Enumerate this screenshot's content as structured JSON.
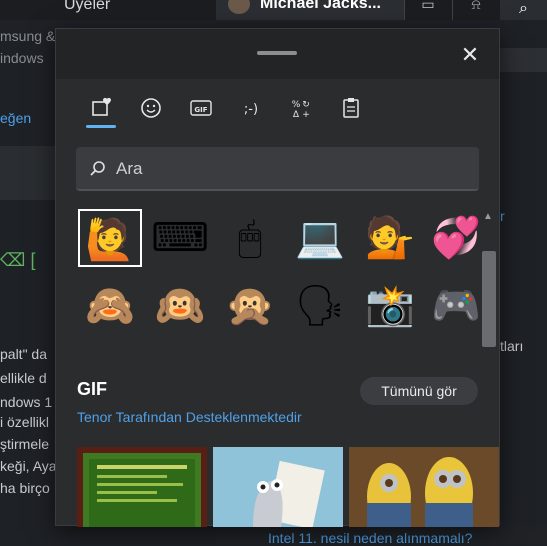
{
  "background": {
    "left_tab": "Üyeler",
    "active_tab_title": "Michael Jacks...",
    "side_lines_left": [
      "msung &",
      "indows"
    ],
    "side_link": "eğen",
    "article_lines": [
      "palt\" da",
      "ellikle d",
      "ndows 1",
      "i özellikl",
      "ştirmele",
      "keği, Aya",
      "ha birço"
    ],
    "right_text": "tları",
    "right_r": "r",
    "bottom_link": "Intel 11. nesil neden alınmamalı?"
  },
  "panel": {
    "close_label": "✕",
    "tabs": [
      {
        "name": "favorites",
        "icon": "heart-square-icon",
        "glyph": "♥"
      },
      {
        "name": "emoji",
        "icon": "smiley-icon",
        "glyph": "☺"
      },
      {
        "name": "gif",
        "icon": "gif-icon",
        "glyph": "GIF"
      },
      {
        "name": "kaomoji",
        "icon": "kaomoji-icon",
        "glyph": ";-)"
      },
      {
        "name": "symbols",
        "icon": "symbols-icon",
        "glyph": "%↻"
      },
      {
        "name": "clipboard",
        "icon": "clipboard-icon",
        "glyph": "📋"
      }
    ],
    "search": {
      "placeholder": "Ara"
    },
    "emoji_row1": [
      "🙋",
      "⌨",
      "🖱",
      "💻",
      "💁",
      "💞"
    ],
    "emoji_row2": [
      "🙈",
      "🙉",
      "🙊",
      "🗣",
      "📸",
      "🎮"
    ],
    "gif_section": {
      "title": "GIF",
      "see_all": "Tümünü gör",
      "powered_by": "Tenor Tarafından Desteklenmektedir"
    },
    "accent_color": "#60b2f2"
  }
}
